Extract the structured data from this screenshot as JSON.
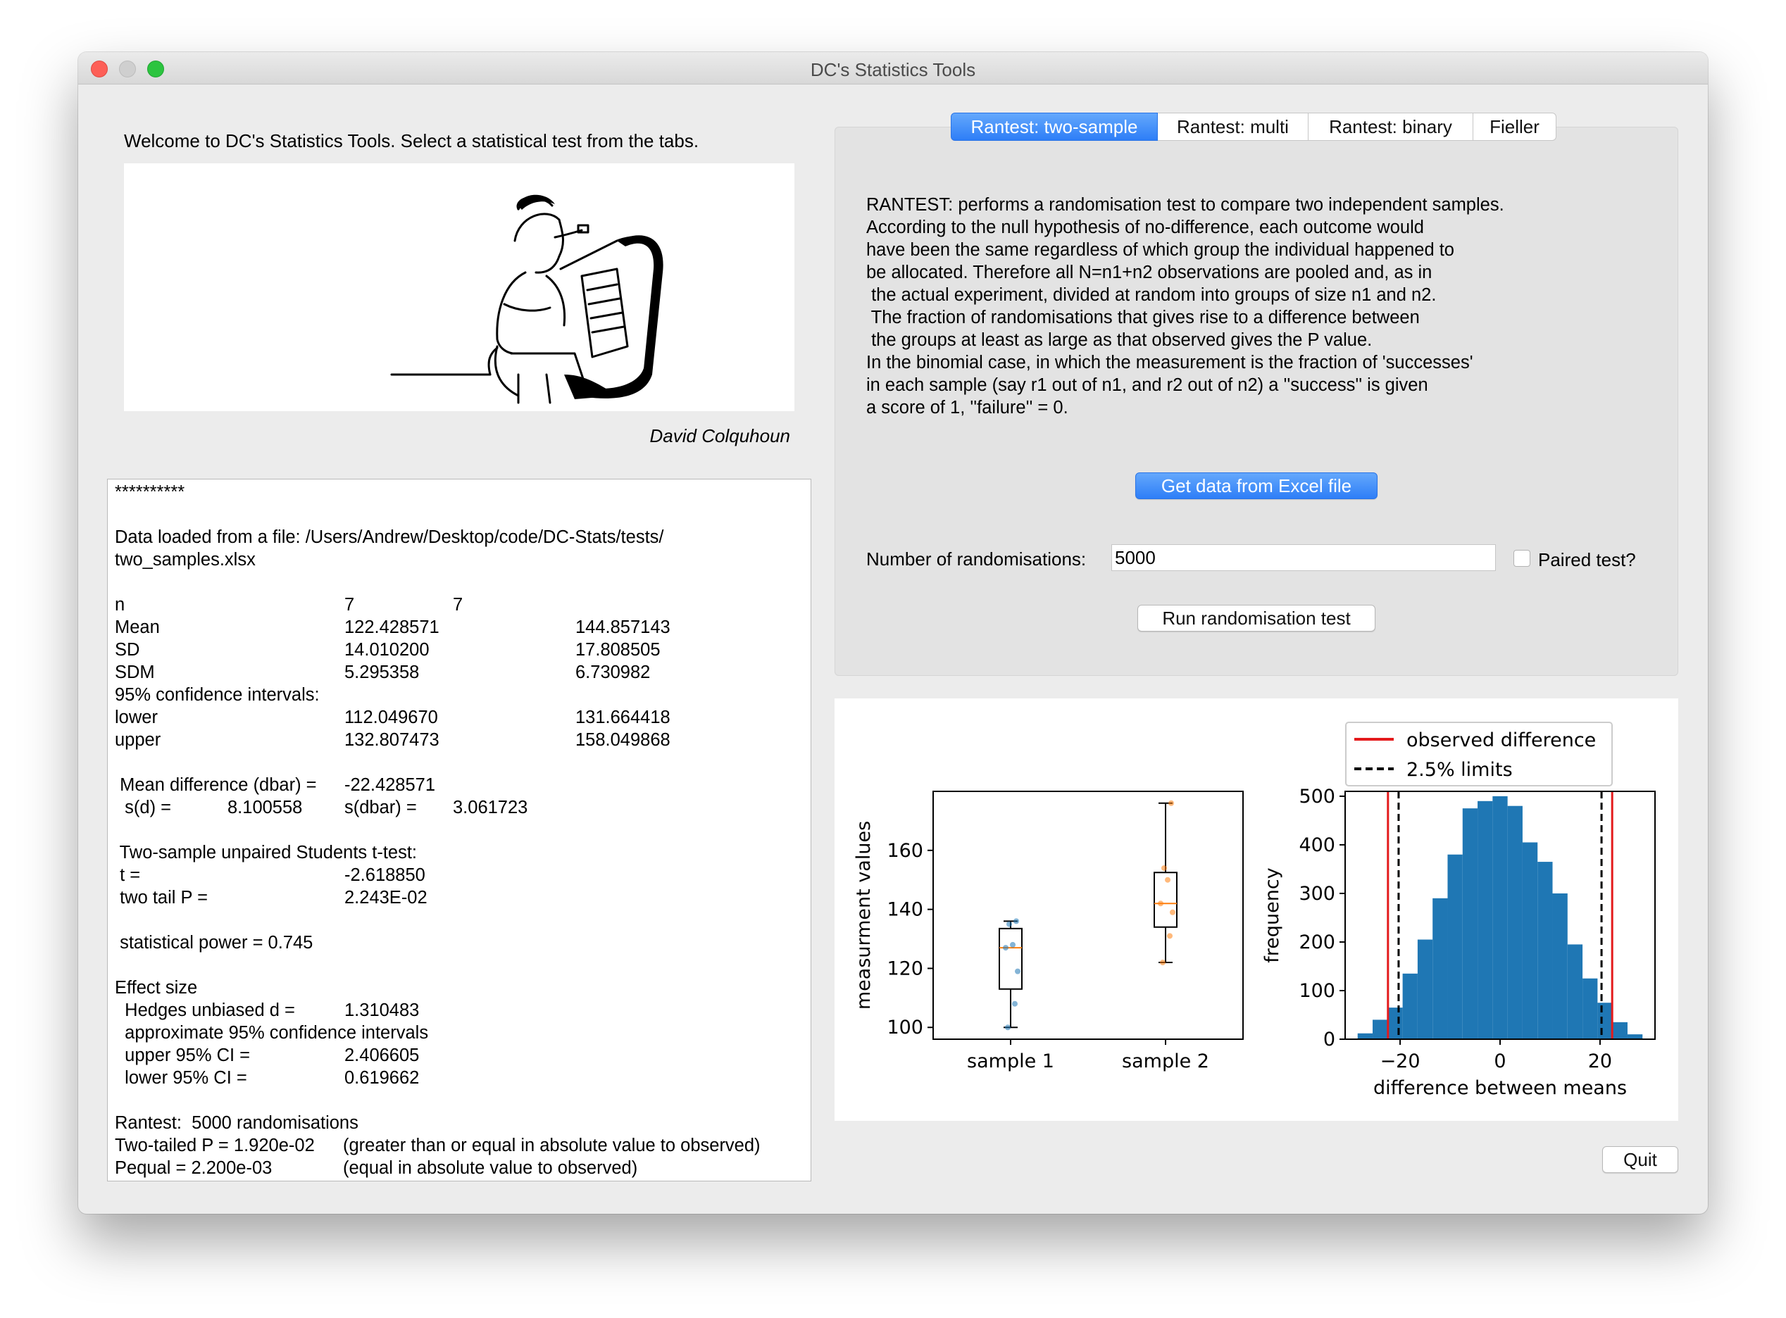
{
  "window": {
    "title": "DC's Statistics Tools"
  },
  "welcome": "Welcome to DC's Statistics Tools. Select a statistical test from the tabs.",
  "credit": "David Colquhoun",
  "output_lines": [
    "**********",
    "",
    "Data loaded from a file: /Users/Andrew/Desktop/code/DC-Stats/tests/",
    "two_samples.xlsx",
    "",
    [
      "n",
      "7",
      "7"
    ],
    [
      "Mean",
      "122.428571",
      "144.857143"
    ],
    [
      "SD",
      "14.010200",
      "17.808505"
    ],
    [
      "SDM",
      "5.295358",
      "6.730982"
    ],
    "95% confidence intervals:",
    [
      "lower",
      "112.049670",
      "131.664418"
    ],
    [
      "upper",
      "132.807473",
      "158.049868"
    ],
    "",
    [
      " Mean difference (dbar) =",
      "-22.428571"
    ],
    [
      "  s(d) =",
      "8.100558",
      "s(dbar) =",
      "3.061723"
    ],
    "",
    " Two-sample unpaired Students t-test:",
    [
      " t =",
      "-2.618850"
    ],
    [
      " two tail P =",
      "2.243E-02"
    ],
    "",
    " statistical power = 0.745",
    "",
    "Effect size",
    [
      "  Hedges unbiased d =",
      "1.310483"
    ],
    "  approximate 95% confidence intervals",
    [
      "  upper 95% CI =",
      "2.406605"
    ],
    [
      "  lower 95% CI =",
      "0.619662"
    ],
    "",
    "Rantest:  5000 randomisations",
    [
      "Two-tailed P = 1.920e-02",
      "(greater than or equal in absolute value to observed)"
    ],
    [
      "Pequal = 2.200e-03",
      "(equal in absolute value to observed)"
    ]
  ],
  "tabs": [
    "Rantest: two-sample",
    "Rantest: multi",
    "Rantest: binary",
    "Fieller"
  ],
  "description": [
    "RANTEST: performs a randomisation test to compare two independent samples.",
    "According to the null hypothesis of no-difference, each outcome would",
    "have been the same regardless of which group the individual happened to",
    "be allocated. Therefore all N=n1+n2 observations are pooled and, as in",
    " the actual experiment, divided at random into groups of size n1 and n2.",
    " The fraction of randomisations that gives rise to a difference between",
    " the groups at least as large as that observed gives the P value.",
    "In the binomial case, in which the measurement is the fraction of 'successes'",
    "in each sample (say r1 out of n1, and r2 out of n2) a ''success'' is given",
    "a score of 1, ''failure'' = 0."
  ],
  "buttons": {
    "excel": "Get data from Excel file",
    "run": "Run randomisation test",
    "quit": "Quit"
  },
  "randomisations": {
    "label": "Number of randomisations:",
    "value": "5000"
  },
  "paired": {
    "label": "Paired test?",
    "checked": false
  },
  "colors": {
    "blue": "#1f77b4",
    "orange": "#ff7f0e",
    "red": "#e41a1c",
    "accent": "#2e7ef7"
  },
  "chart_data": [
    {
      "type": "box",
      "ylabel": "measurment values",
      "categories": [
        "sample 1",
        "sample 2"
      ],
      "yticks": [
        100,
        120,
        140,
        160
      ],
      "ylim": [
        96,
        180
      ],
      "boxes": [
        {
          "whislo": 100,
          "q1": 113,
          "med": 127,
          "q3": 133.5,
          "whishi": 136,
          "color": "#1f77b4",
          "points": [
            100,
            108,
            119,
            127,
            128,
            135,
            136
          ]
        },
        {
          "whislo": 122,
          "q1": 134,
          "med": 142,
          "q3": 152.5,
          "whishi": 176,
          "color": "#ff7f0e",
          "points": [
            122,
            131,
            139,
            142,
            150,
            154,
            176
          ]
        }
      ]
    },
    {
      "type": "bar",
      "xlabel": "difference between means",
      "ylabel": "frequency",
      "xticks": [
        "−20",
        "0",
        "20"
      ],
      "xtick_values": [
        -20,
        0,
        20
      ],
      "yticks": [
        0,
        100,
        200,
        300,
        400,
        500
      ],
      "xlim": [
        -31,
        31
      ],
      "ylim": [
        0,
        510
      ],
      "bin_start": -28.5,
      "bin_width": 3.0,
      "values": [
        12,
        40,
        65,
        135,
        205,
        290,
        380,
        475,
        490,
        500,
        480,
        405,
        365,
        300,
        195,
        125,
        75,
        35,
        10
      ],
      "legend": [
        {
          "label": "observed difference",
          "style": "solid",
          "color": "#e41a1c"
        },
        {
          "label": "2.5% limits",
          "style": "dashed",
          "color": "#000000"
        }
      ],
      "observed_lines": [
        -22.43,
        22.43
      ],
      "limit_lines": [
        -20.3,
        20.3
      ]
    }
  ]
}
